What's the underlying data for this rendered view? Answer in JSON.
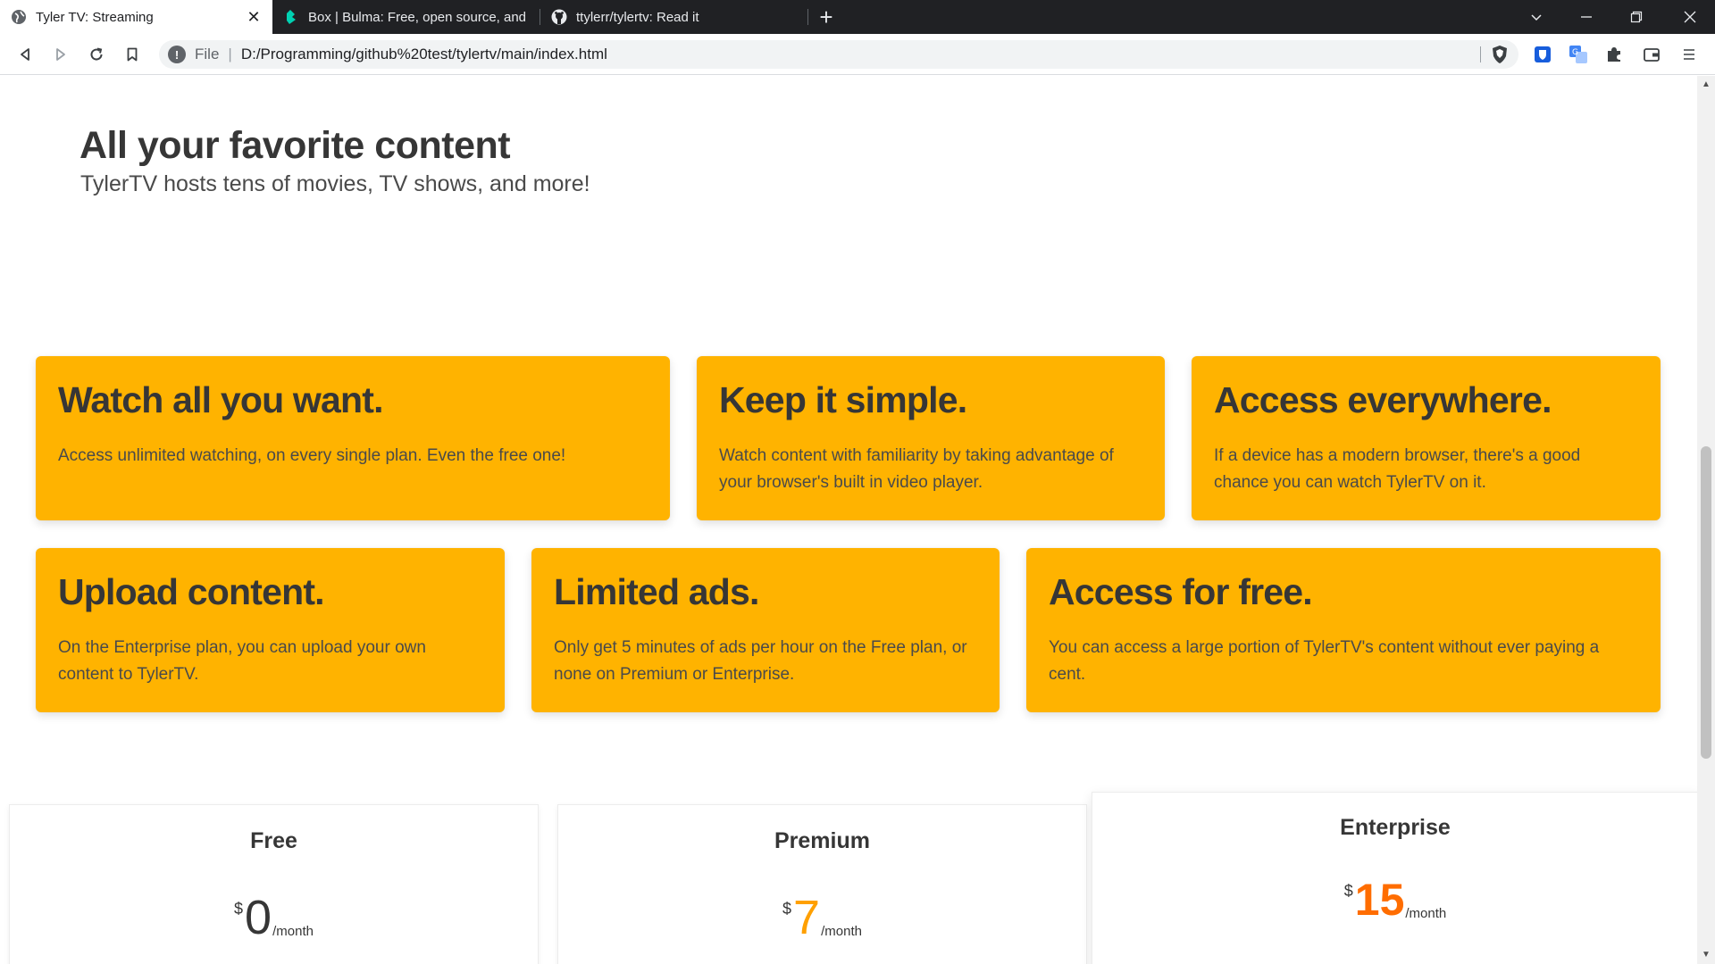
{
  "browser": {
    "tabs": [
      {
        "title": "Tyler TV: Streaming",
        "active": true
      },
      {
        "title": "Box | Bulma: Free, open source, and m",
        "active": false
      },
      {
        "title": "ttylerr/tylertv: Read it",
        "active": false
      }
    ],
    "new_tab": "+",
    "address": {
      "scheme": "File",
      "separator": "|",
      "url": "D:/Programming/github%20test/tylertv/main/index.html"
    },
    "icons": {
      "back": "back-arrow-icon",
      "forward": "forward-arrow-icon",
      "reload": "reload-icon",
      "bookmark": "bookmark-icon",
      "info": "info-icon",
      "shield": "brave-shield-icon",
      "extensions": [
        "bitwarden-icon",
        "translate-icon",
        "puzzle-icon",
        "wallet-icon",
        "menu-icon"
      ]
    },
    "info_glyph": "!",
    "close_glyph": "✕"
  },
  "hero": {
    "title": "All your favorite content",
    "subtitle": "TylerTV hosts tens of movies, TV shows, and more!"
  },
  "features": [
    {
      "title": "Watch all you want.",
      "text": "Access unlimited watching, on every single plan. Even the free one!"
    },
    {
      "title": "Keep it simple.",
      "text": "Watch content with familiarity by taking advantage of your browser's built in video player."
    },
    {
      "title": "Access everywhere.",
      "text": "If a device has a modern browser, there's a good chance you can watch TylerTV on it."
    },
    {
      "title": "Upload content.",
      "text": "On the Enterprise plan, you can upload your own content to TylerTV."
    },
    {
      "title": "Limited ads.",
      "text": "Only get 5 minutes of ads per hour on the Free plan, or none on Premium or Enterprise."
    },
    {
      "title": "Access for free.",
      "text": "You can access a large portion of TylerTV's content without ever paying a cent."
    }
  ],
  "plans": [
    {
      "name": "Free",
      "currency": "$",
      "amount": "0",
      "period": "/month",
      "color": "#363636"
    },
    {
      "name": "Premium",
      "currency": "$",
      "amount": "7",
      "period": "/month",
      "color": "#ffa000"
    },
    {
      "name": "Enterprise",
      "currency": "$",
      "amount": "15",
      "period": "/month",
      "color": "#ff6d00"
    }
  ],
  "colors": {
    "card": "#ffb300",
    "premium": "#ffa000",
    "enterprise": "#ff6d00"
  }
}
